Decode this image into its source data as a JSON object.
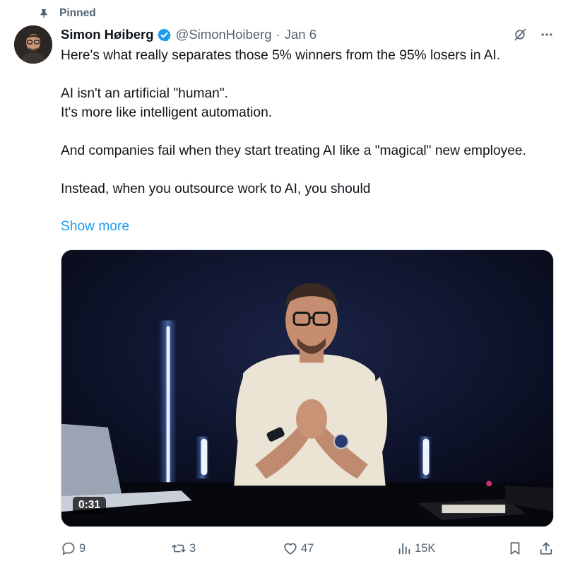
{
  "pinned_label": "Pinned",
  "author": {
    "name": "Simon Høiberg",
    "handle": "@SimonHoiberg",
    "separator": "·",
    "date": "Jan 6",
    "verified": true
  },
  "tweet": {
    "paragraphs": [
      [
        "Here's what really separates those 5% winners from the 95% losers in AI."
      ],
      [
        "AI isn't an artificial \"human\".",
        "It's more like intelligent automation."
      ],
      [
        "And companies fail when they start treating AI like a \"magical\" new employee."
      ],
      [
        "Instead, when you outsource work to AI, you should"
      ]
    ],
    "show_more": "Show more"
  },
  "media": {
    "type": "video",
    "duration": "0:31"
  },
  "actions": {
    "replies": "9",
    "reposts": "3",
    "likes": "47",
    "views": "15K"
  },
  "colors": {
    "accent": "#1d9bf0",
    "muted": "#536471",
    "text": "#0f1419"
  },
  "icons": [
    "pin-icon",
    "verified-badge-icon",
    "grok-icon",
    "more-icon",
    "reply-icon",
    "repost-icon",
    "like-icon",
    "views-icon",
    "bookmark-icon",
    "share-icon"
  ]
}
